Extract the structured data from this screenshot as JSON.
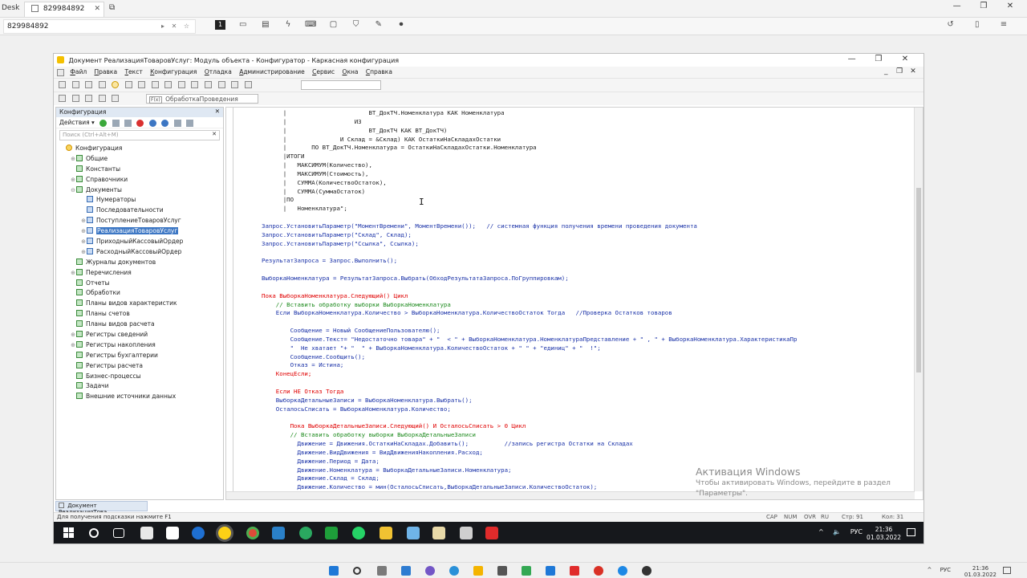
{
  "rd_app": {
    "brand": "Desk",
    "tab_title": "829984892",
    "tab_close": "✕",
    "new_tab": "⧉",
    "address": "829984892",
    "address_actions": "▸ ✕ ☆",
    "window_controls": [
      "—",
      "❐",
      "✕"
    ],
    "tool_badge": "1",
    "right_tools": [
      "↺",
      "▯",
      "≡"
    ]
  },
  "window": {
    "title": "Документ РеализацияТоваровУслуг: Модуль объекта - Конфигуратор - Каркасная конфигурация",
    "controls": [
      "—",
      "❐",
      "✕"
    ],
    "sub_controls": [
      "_",
      "❐",
      "✕"
    ]
  },
  "menu": [
    "Файл",
    "Правка",
    "Текст",
    "Конфигурация",
    "Отладка",
    "Администрирование",
    "Сервис",
    "Окна",
    "Справка"
  ],
  "toolbar": {
    "procedure_combo": "ОбработкаПроведения",
    "fx_label": "F(x)"
  },
  "config_panel": {
    "title": "Конфигурация",
    "close": "✕",
    "actions_label": "Действия ▾",
    "search_placeholder": "Поиск (Ctrl+Alt+M)",
    "search_clear": "✕",
    "tree": [
      {
        "label": "Конфигурация",
        "level": 0,
        "exp": ""
      },
      {
        "label": "Общие",
        "level": 1,
        "exp": "⊕"
      },
      {
        "label": "Константы",
        "level": 1,
        "exp": ""
      },
      {
        "label": "Справочники",
        "level": 1,
        "exp": "⊕"
      },
      {
        "label": "Документы",
        "level": 1,
        "exp": "⊖"
      },
      {
        "label": "Нумераторы",
        "level": 2,
        "exp": ""
      },
      {
        "label": "Последовательности",
        "level": 2,
        "exp": ""
      },
      {
        "label": "ПоступлениеТоваровУслуг",
        "level": 2,
        "exp": "⊕"
      },
      {
        "label": "РеализацияТоваровУслуг",
        "level": 2,
        "exp": "⊕",
        "selected": true
      },
      {
        "label": "ПриходныйКассовыйОрдер",
        "level": 2,
        "exp": "⊕"
      },
      {
        "label": "РасходныйКассовыйОрдер",
        "level": 2,
        "exp": "⊕"
      },
      {
        "label": "Журналы документов",
        "level": 1,
        "exp": ""
      },
      {
        "label": "Перечисления",
        "level": 1,
        "exp": "⊕"
      },
      {
        "label": "Отчеты",
        "level": 1,
        "exp": ""
      },
      {
        "label": "Обработки",
        "level": 1,
        "exp": ""
      },
      {
        "label": "Планы видов характеристик",
        "level": 1,
        "exp": ""
      },
      {
        "label": "Планы счетов",
        "level": 1,
        "exp": ""
      },
      {
        "label": "Планы видов расчета",
        "level": 1,
        "exp": ""
      },
      {
        "label": "Регистры сведений",
        "level": 1,
        "exp": "⊕"
      },
      {
        "label": "Регистры накопления",
        "level": 1,
        "exp": "⊕"
      },
      {
        "label": "Регистры бухгалтерии",
        "level": 1,
        "exp": ""
      },
      {
        "label": "Регистры расчета",
        "level": 1,
        "exp": ""
      },
      {
        "label": "Бизнес-процессы",
        "level": 1,
        "exp": ""
      },
      {
        "label": "Задачи",
        "level": 1,
        "exp": ""
      },
      {
        "label": "Внешние источники данных",
        "level": 1,
        "exp": ""
      }
    ]
  },
  "code_lines": [
    {
      "t": "      |                       ВТ_ДокТЧ.Номенклатура КАК Номенклатура",
      "c": "qt"
    },
    {
      "t": "      |                   ИЗ",
      "c": "qt"
    },
    {
      "t": "      |                       ВТ_ДокТЧ КАК ВТ_ДокТЧ)",
      "c": "qt"
    },
    {
      "t": "      |               И Склад = &Склад) КАК ОстаткиНаСкладахОстатки",
      "c": "qt"
    },
    {
      "t": "      |       ПО ВТ_ДокТЧ.Номенклатура = ОстаткиНаСкладахОстатки.Номенклатура",
      "c": "qt"
    },
    {
      "t": "      |ИТОГИ",
      "c": "qt"
    },
    {
      "t": "      |   МАКСИМУМ(Количество),",
      "c": "qt"
    },
    {
      "t": "      |   МАКСИМУМ(Стоимость),",
      "c": "qt"
    },
    {
      "t": "      |   СУММА(КоличествоОстаток),",
      "c": "qt"
    },
    {
      "t": "      |   СУММА(СуммаОстаток)",
      "c": "qt"
    },
    {
      "t": "      |ПО",
      "c": "qt"
    },
    {
      "t": "      |   Номенклатура\";",
      "c": "qt"
    },
    {
      "t": "",
      "c": ""
    },
    {
      "t": "Запрос.УстановитьПараметр(\"МоментВремени\", МоментВремени());   // системная функция получения времени проведения документа",
      "c": "id"
    },
    {
      "t": "Запрос.УстановитьПараметр(\"Склад\", Склад);",
      "c": "id"
    },
    {
      "t": "Запрос.УстановитьПараметр(\"Ссылка\", Ссылка);",
      "c": "id"
    },
    {
      "t": "",
      "c": ""
    },
    {
      "t": "РезультатЗапроса = Запрос.Выполнить();",
      "c": "id"
    },
    {
      "t": "",
      "c": ""
    },
    {
      "t": "ВыборкаНоменклатура = РезультатЗапроса.Выбрать(ОбходРезультатаЗапроса.ПоГруппировкам);",
      "c": "id"
    },
    {
      "t": "",
      "c": ""
    },
    {
      "t": "Пока ВыборкаНоменклатура.Следующий() Цикл",
      "c": "kw"
    },
    {
      "t": "    // Вставить обработку выборки ВыборкаНоменклатура",
      "c": "cm"
    },
    {
      "t": "    Если ВыборкаНоменклатура.Количество > ВыборкаНоменклатура.КоличествоОстаток Тогда   //Проверка Остатков товаров",
      "c": "id"
    },
    {
      "t": "",
      "c": ""
    },
    {
      "t": "        Сообщение = Новый СообщениеПользователю();",
      "c": "id"
    },
    {
      "t": "        Сообщение.Текст= \"Недостаточно товара\" + \"  < \" + ВыборкаНоменклатура.НоменклатураПредставление + \" , \" + ВыборкаНоменклатура.ХарактеристикаПр",
      "c": "id"
    },
    {
      "t": "        \"  Не хватает \"+ \"  \" + ВыборкаНоменклатура.КоличествоОстаток + \" \" + \"единиц\" + \"  !\";",
      "c": "id"
    },
    {
      "t": "        Сообщение.Сообщить();",
      "c": "id"
    },
    {
      "t": "        Отказ = Истина;",
      "c": "id"
    },
    {
      "t": "    КонецЕсли;",
      "c": "kw"
    },
    {
      "t": "",
      "c": ""
    },
    {
      "t": "    Если НЕ Отказ Тогда",
      "c": "kw"
    },
    {
      "t": "    ВыборкаДетальныеЗаписи = ВыборкаНоменклатура.Выбрать();",
      "c": "id"
    },
    {
      "t": "    ОсталосьСписать = ВыборкаНоменклатура.Количество;",
      "c": "id"
    },
    {
      "t": "",
      "c": ""
    },
    {
      "t": "        Пока ВыборкаДетальныеЗаписи.Следующий() И ОсталосьСписать > 0 Цикл",
      "c": "kw"
    },
    {
      "t": "        // Вставить обработку выборки ВыборкаДетальныеЗаписи",
      "c": "cm"
    },
    {
      "t": "          Движение = Движения.ОстаткиНаСкладах.Добавить();          //запись регистра Остатки на Складах",
      "c": "id"
    },
    {
      "t": "          Движение.ВидДвижения = ВидДвиженияНакопления.Расход;",
      "c": "id"
    },
    {
      "t": "          Движение.Период = Дата;",
      "c": "id"
    },
    {
      "t": "          Движение.Номенклатура = ВыборкаДетальныеЗаписи.Номенклатура;",
      "c": "id"
    },
    {
      "t": "          Движение.Склад = Склад;",
      "c": "id"
    },
    {
      "t": "          Движение.Количество = мин(ОсталосьСписать,ВыборкаДетальныеЗаписи.КоличествоОстаток);",
      "c": "id"
    }
  ],
  "watermark": {
    "title": "Активация Windows",
    "line1": "Чтобы активировать Windows, перейдите в раздел",
    "line2": "\"Параметры\"."
  },
  "window_tab": "Документ РеализацияТова...",
  "status": {
    "hint": "Для получения подсказки нажмите F1",
    "cap": "CAP",
    "num": "NUM",
    "ovr": "OVR",
    "ru": "RU",
    "line": "Стр: 91",
    "col": "Кол: 31"
  },
  "remote_taskbar": {
    "tray": [
      "^",
      "🔈",
      "РУС"
    ],
    "time": "21:36",
    "date": "01.03.2022"
  },
  "host_taskbar": {
    "tray": [
      "^",
      "РУС"
    ],
    "time": "21:36",
    "date": "01.03.2022"
  }
}
